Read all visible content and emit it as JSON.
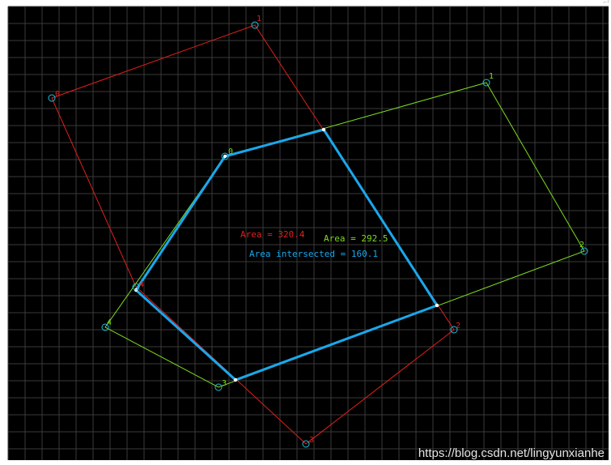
{
  "colors": {
    "background": "#000000",
    "grid": "#3a3a3a",
    "polygon_a": "#e0201c",
    "polygon_b": "#7ddc1f",
    "intersection": "#1aa7ec",
    "vertex_marker": "#1fbfdc",
    "intersection_point": "#ffffff"
  },
  "polygon_a": {
    "vertex_labels": [
      "0",
      "1",
      "2",
      "3",
      "4"
    ]
  },
  "polygon_b": {
    "vertex_labels": [
      "0",
      "1",
      "2",
      "3",
      "4"
    ]
  },
  "annotations": {
    "area_a": "Area = 320.4",
    "area_b": "Area = 292.5",
    "area_intersected": "Area intersected = 160.1"
  },
  "watermark": "https://blog.csdn.net/lingyunxianhe",
  "corner_mark": "⌐ᐧᑦ"
}
